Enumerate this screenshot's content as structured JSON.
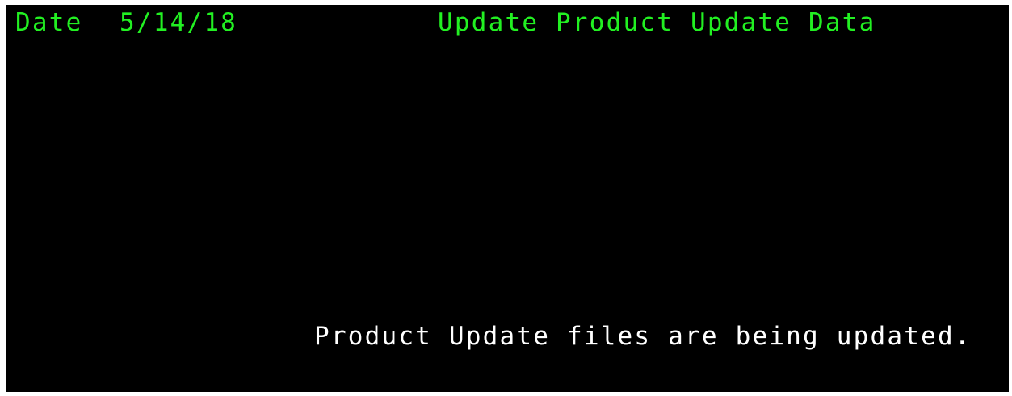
{
  "header": {
    "date_label": "Date",
    "date_value": "5/14/18",
    "title": "Update Product Update Data"
  },
  "message": {
    "status": "Product Update files are being updated."
  },
  "colors": {
    "background": "#000000",
    "header_text": "#22f022",
    "message_text": "#ffffff"
  }
}
